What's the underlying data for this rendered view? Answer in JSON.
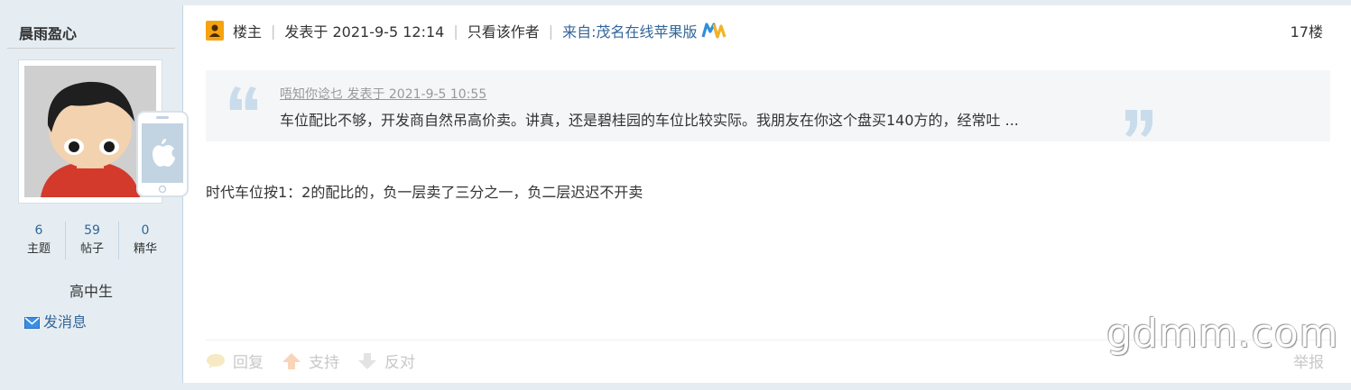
{
  "author": {
    "username": "晨雨盈心",
    "stats": [
      {
        "value": "6",
        "label": "主题"
      },
      {
        "value": "59",
        "label": "帖子"
      },
      {
        "value": "0",
        "label": "精华"
      }
    ],
    "rank": "高中生",
    "send_message": "发消息"
  },
  "post": {
    "owner_label": "楼主",
    "posted_at": "发表于 2021-9-5 12:14",
    "only_author": "只看该作者",
    "source": "来自:茂名在线苹果版",
    "floor": "17楼",
    "quote": {
      "meta": "唔知你谂乜 发表于 2021-9-5 10:55",
      "text": "车位配比不够，开发商自然吊高价卖。讲真，还是碧桂园的车位比较实际。我朋友在你这个盘买140方的，经常吐 ..."
    },
    "body": "时代车位按1：2的配比的，负一层卖了三分之一，负二层迟迟不开卖",
    "actions": {
      "reply": "回复",
      "support": "支持",
      "oppose": "反对",
      "report": "举报"
    }
  },
  "watermark": "gdmm.com"
}
